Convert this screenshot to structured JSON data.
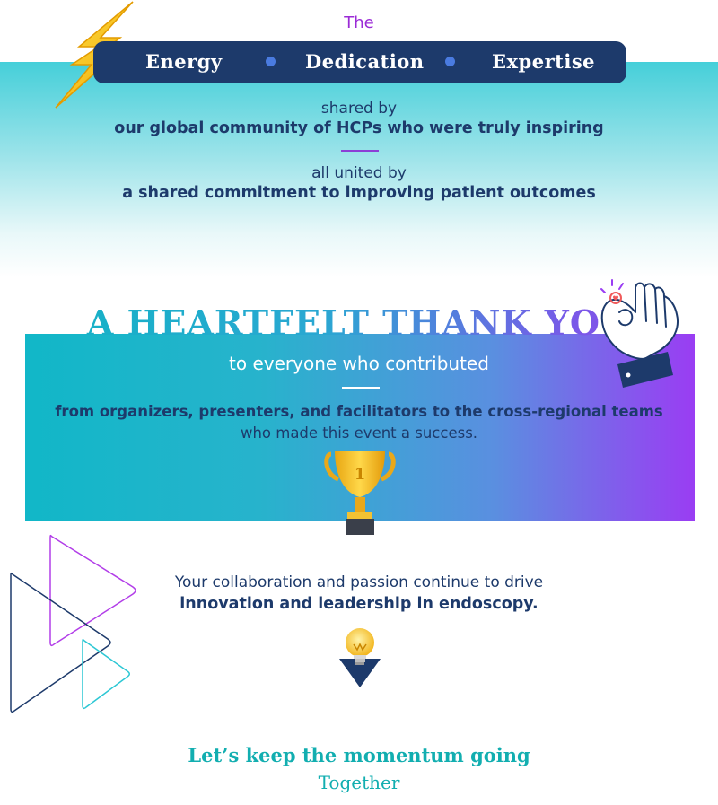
{
  "header": {
    "intro": "The",
    "pillars": [
      "Energy",
      "Dedication",
      "Expertise"
    ]
  },
  "community": {
    "line1_light": "shared by",
    "line1_bold": "our global community of HCPs who were truly inspiring",
    "line2_light": "all united by",
    "line2_bold": "a shared commitment to improving patient outcomes"
  },
  "thanks": {
    "title": "A HEARTFELT THANK YOU",
    "subtitle": "to everyone who contributed",
    "bold_line": "from organizers, presenters, and facilitators to the cross-regional teams",
    "light_line": "who made this event a success."
  },
  "trophy": {
    "number": "1"
  },
  "collaboration": {
    "light_line": "Your collaboration and passion continue to drive",
    "bold_line": "innovation and leadership in endoscopy."
  },
  "closing": {
    "bold_line": "Let’s keep the momentum going",
    "light_line": "Together"
  },
  "icons": [
    "lightning-bolt-icon",
    "ok-hand-icon",
    "trophy-icon",
    "play-arrows-icon",
    "lightbulb-icon"
  ],
  "colors": {
    "navy": "#1d3a6b",
    "teal": "#12aeb0",
    "purple": "#9a3df3",
    "accent_blue": "#4a7be0",
    "gold": "#f2b51c"
  }
}
